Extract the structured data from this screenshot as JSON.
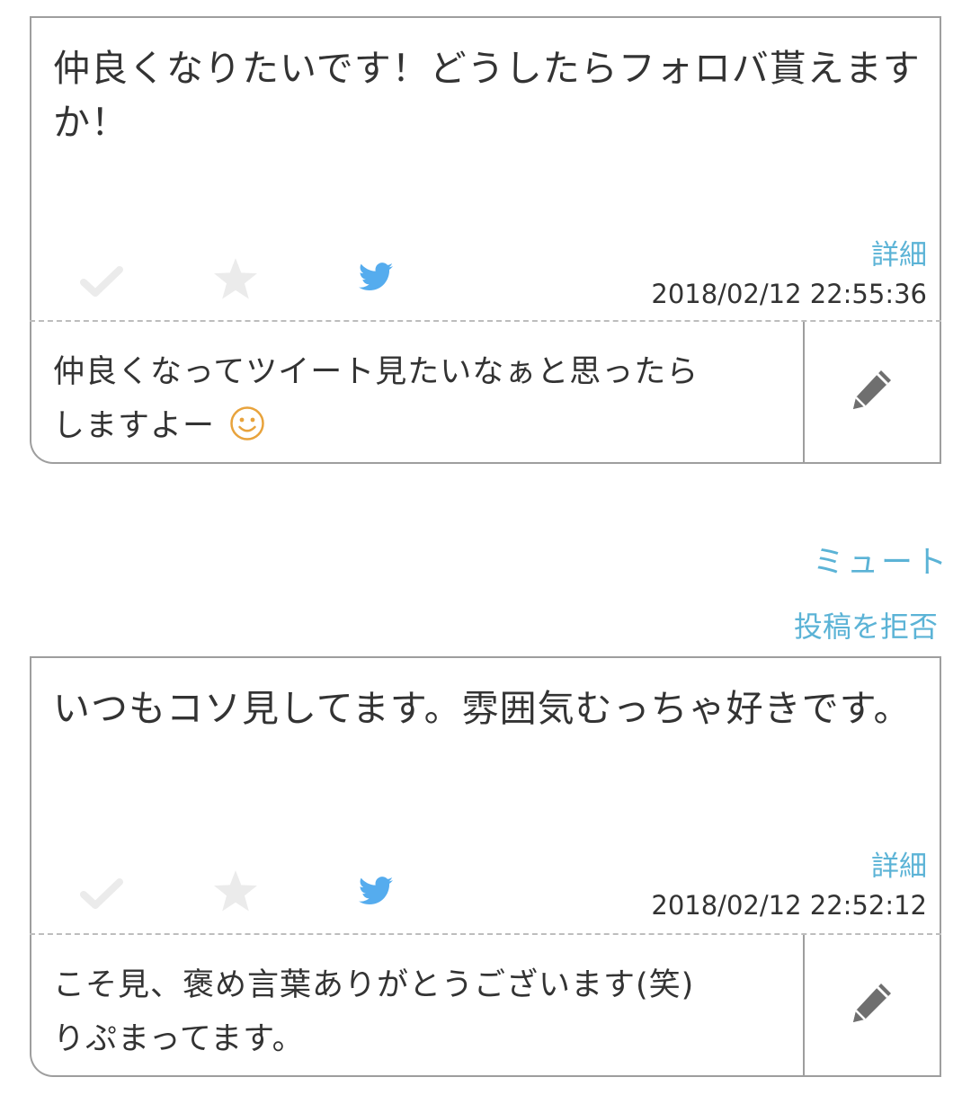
{
  "posts": [
    {
      "question": "仲良くなりたいです！どうしたらフォロバ貰えますか！",
      "detail_label": "詳細",
      "timestamp": "2018/02/12 22:55:36",
      "answer_line1": "仲良くなってツイート見たいなぁと思ったら",
      "answer_line2": "しますよー"
    },
    {
      "question": "いつもコソ見してます。雰囲気むっちゃ好きです。",
      "detail_label": "詳細",
      "timestamp": "2018/02/12 22:52:12",
      "answer_line1": "こそ見、褒め言葉ありがとうございます(笑)",
      "answer_line2": "りぷまってます。"
    }
  ],
  "moderation": {
    "mute_label": "ミュート",
    "reject_label": "投稿を拒否"
  },
  "colors": {
    "link": "#5bb3d6",
    "border": "#9e9e9e",
    "icon_muted": "#ebebeb",
    "twitter": "#55acee",
    "smiley": "#e8a33c"
  },
  "icons": [
    "check-icon",
    "star-icon",
    "twitter-icon",
    "pencil-icon",
    "smiley-icon"
  ]
}
